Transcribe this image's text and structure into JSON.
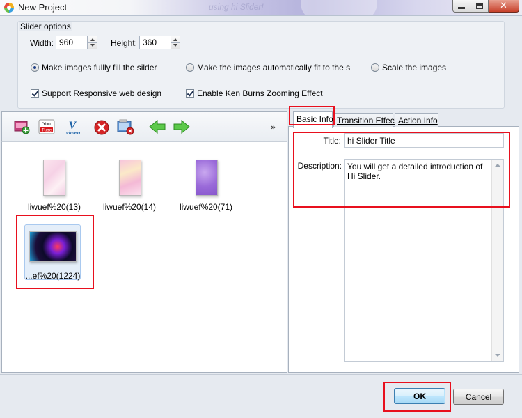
{
  "window": {
    "title": "New Project",
    "background_watermark": "using hi Slider!"
  },
  "slider_options": {
    "group_label": "Slider options",
    "width_label": "Width:",
    "width_value": "960",
    "height_label": "Height:",
    "height_value": "360",
    "fit_modes": [
      {
        "label": "Make images fullly fill the silder",
        "selected": true
      },
      {
        "label": "Make the images automatically fit to the slider",
        "selected": false
      },
      {
        "label": "Scale the images",
        "selected": false
      }
    ],
    "checkboxes": [
      {
        "label": "Support Responsive web design",
        "checked": true
      },
      {
        "label": "Enable Ken Burns Zooming Effect",
        "checked": true
      }
    ]
  },
  "toolbar": {
    "items": [
      "add-image",
      "youtube",
      "vimeo",
      "remove",
      "remove-all",
      "move-left",
      "move-right"
    ],
    "youtube_text": "You Tube",
    "vimeo_text": "vimeo",
    "more": "»"
  },
  "images": [
    {
      "caption": "liwuef%20(13)",
      "selected": false
    },
    {
      "caption": "liwuef%20(14)",
      "selected": false
    },
    {
      "caption": "liwuef%20(71)",
      "selected": false
    },
    {
      "caption": "...ef%20(1224)",
      "selected": true
    }
  ],
  "tabs": [
    {
      "label": "Basic Info",
      "active": true
    },
    {
      "label": "Transition Effect",
      "active": false
    },
    {
      "label": "Action Info",
      "active": false
    }
  ],
  "basic_info": {
    "title_label": "Title:",
    "title_value": "hi Slider Title",
    "description_label": "Description:",
    "description_value": "You will get a detailed introduction of Hi Slider."
  },
  "buttons": {
    "ok": "OK",
    "cancel": "Cancel"
  },
  "colors": {
    "highlight_red": "#e8101e",
    "selection_blue": "#e4eef9",
    "default_button": "#a7d9f5"
  }
}
